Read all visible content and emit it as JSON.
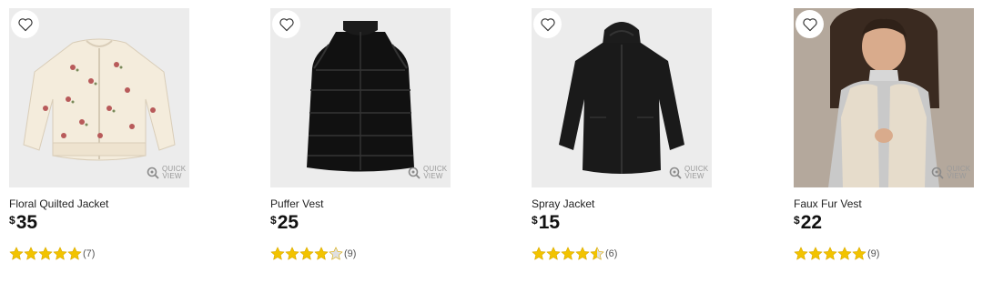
{
  "quick_view_label": "QUICK VIEW",
  "colors": {
    "star": "#f2c300",
    "star_empty": "#e0e0e0",
    "image_bg": "#ebebeb"
  },
  "products": [
    {
      "name": "Floral Quilted Jacket",
      "currency": "$",
      "price": "35",
      "rating": 5,
      "review_count": "(7)",
      "image_icon": "floral-jacket"
    },
    {
      "name": "Puffer Vest",
      "currency": "$",
      "price": "25",
      "rating": 4,
      "review_count": "(9)",
      "image_icon": "puffer-vest"
    },
    {
      "name": "Spray Jacket",
      "currency": "$",
      "price": "15",
      "rating": 4.5,
      "review_count": "(6)",
      "image_icon": "spray-jacket"
    },
    {
      "name": "Faux Fur Vest",
      "currency": "$",
      "price": "22",
      "rating": 5,
      "review_count": "(9)",
      "image_icon": "faux-fur-vest"
    }
  ]
}
